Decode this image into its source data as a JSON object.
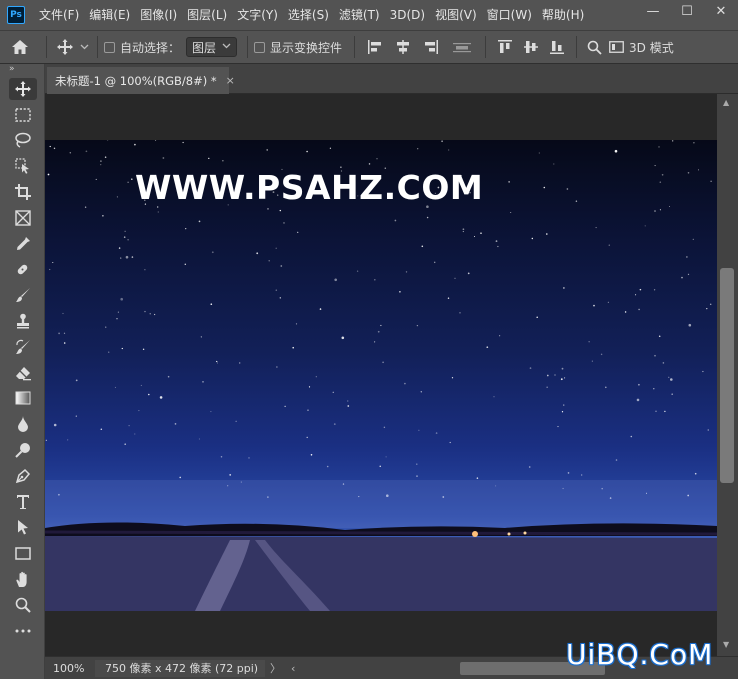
{
  "app": {
    "logo_text": "Ps"
  },
  "menu": [
    "文件(F)",
    "编辑(E)",
    "图像(I)",
    "图层(L)",
    "文字(Y)",
    "选择(S)",
    "滤镜(T)",
    "3D(D)",
    "视图(V)",
    "窗口(W)",
    "帮助(H)"
  ],
  "window_controls": {
    "minimize": "—",
    "maximize": "☐",
    "close": "✕"
  },
  "options": {
    "auto_select_label": "自动选择：",
    "auto_select_value": "图层",
    "show_transform_label": "显示变换控件",
    "mode_3d_label": "3D 模式"
  },
  "document": {
    "tab_title": "未标题-1 @ 100%(RGB/8#) *",
    "close_glyph": "×",
    "watermark": "WWW.PSAHZ.COM"
  },
  "status": {
    "zoom": "100%",
    "doc_info": "750 像素 x 472 像素 (72 ppi)",
    "expand_glyph": "〉",
    "scroll_left_glyph": "‹"
  },
  "branding": {
    "text": "UiBQ.CoM"
  },
  "colors": {
    "ui_bg": "#535353",
    "canvas_bg": "#282828",
    "accent": "#31a8ff",
    "brand_outline": "#1a6fd0"
  },
  "tools": [
    "move-tool",
    "marquee-tool",
    "lasso-tool",
    "object-select-tool",
    "crop-tool",
    "frame-tool",
    "eyedropper-tool",
    "healing-tool",
    "brush-tool",
    "stamp-tool",
    "history-brush-tool",
    "eraser-tool",
    "gradient-tool",
    "blur-tool",
    "dodge-tool",
    "pen-tool",
    "type-tool",
    "path-select-tool",
    "rectangle-tool",
    "hand-tool",
    "zoom-tool",
    "more-tools"
  ]
}
